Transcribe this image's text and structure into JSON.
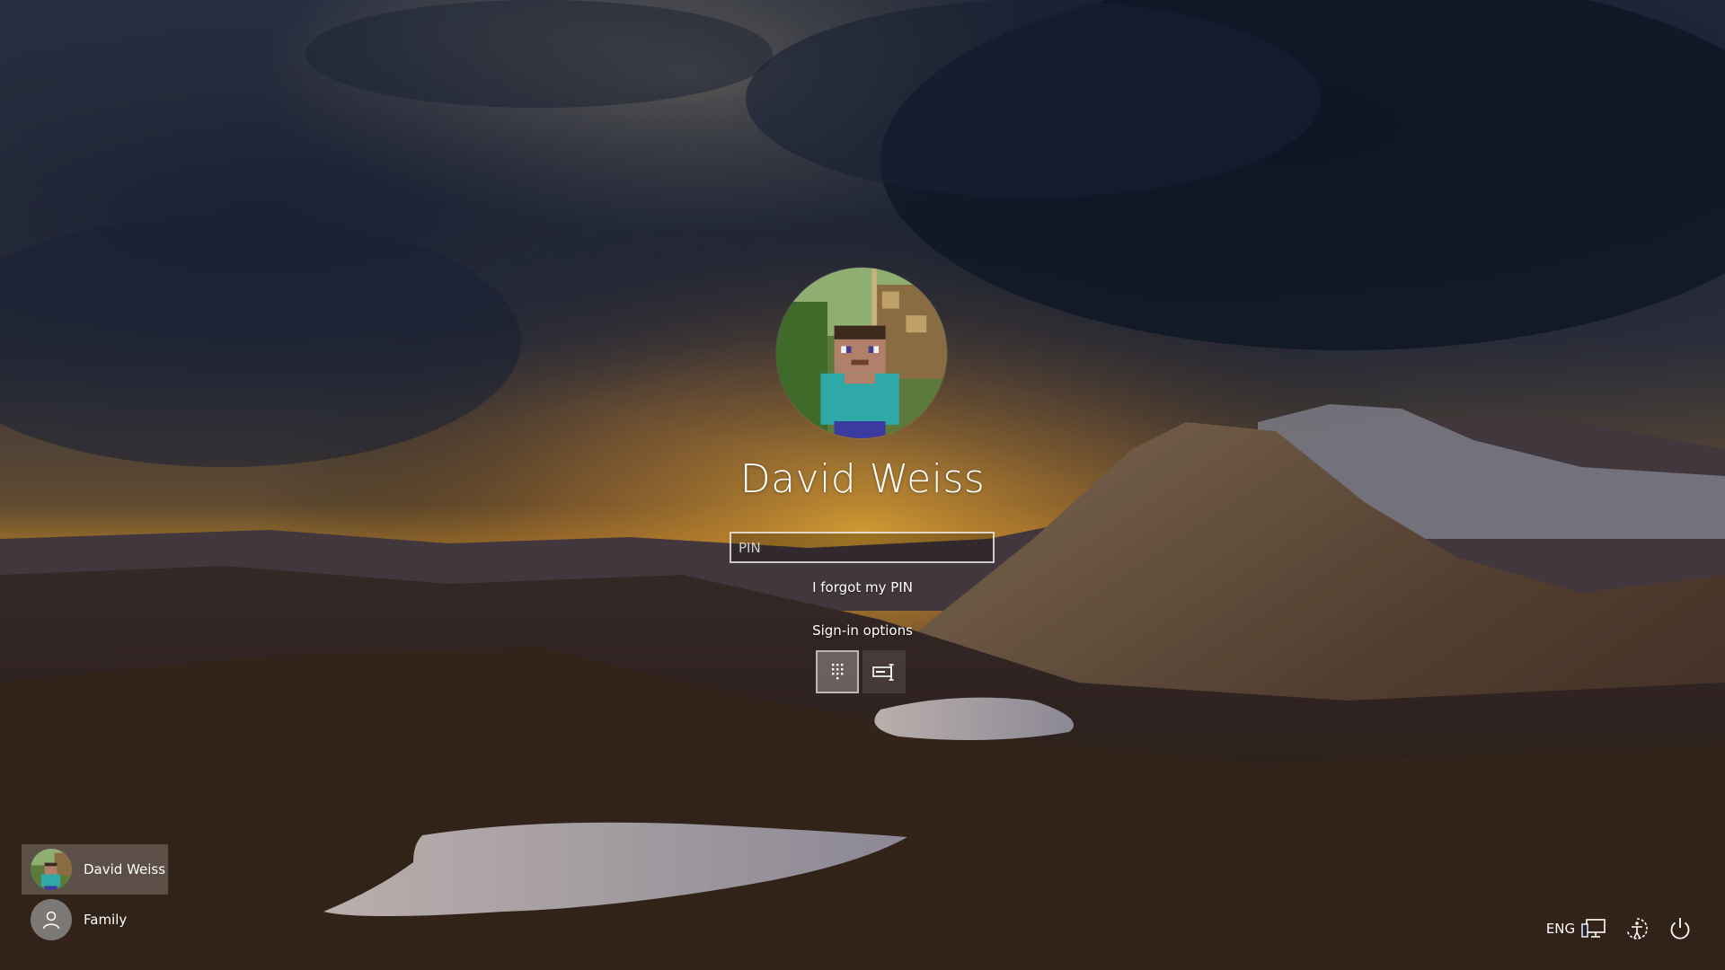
{
  "user": {
    "display_name": "David Weiss"
  },
  "pin_field": {
    "placeholder": "PIN",
    "value": ""
  },
  "links": {
    "forgot_pin": "I forgot my PIN",
    "sign_in_options": "Sign-in options"
  },
  "sign_in_methods": [
    {
      "icon": "pin-keypad-icon",
      "selected": true
    },
    {
      "icon": "password-key-icon",
      "selected": false
    }
  ],
  "user_list": [
    {
      "name": "David Weiss",
      "avatar": "minecraft-steve-avatar",
      "selected": true
    },
    {
      "name": "Family",
      "avatar": "generic-user-icon",
      "selected": false
    }
  ],
  "tray": {
    "language": "ENG",
    "icons": [
      "network-icon",
      "ease-of-access-icon",
      "power-icon"
    ]
  },
  "colors": {
    "text": "#ffffff",
    "selected_tile": "rgba(255,255,255,0.20)"
  }
}
